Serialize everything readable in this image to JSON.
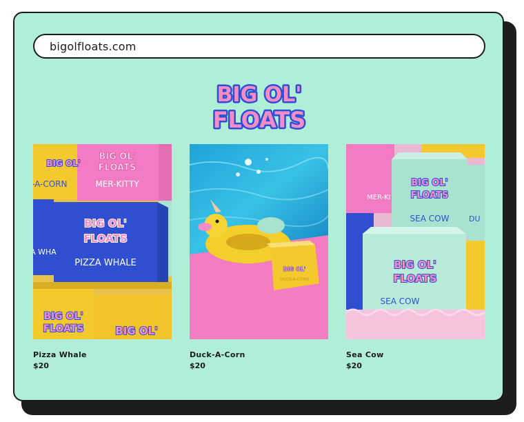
{
  "browser": {
    "url": "bigolfloats.com"
  },
  "brand": {
    "logo_line1": "BIG OL'",
    "logo_line2": "FLOATS"
  },
  "products": [
    {
      "name": "Pizza Whale",
      "price": "$20"
    },
    {
      "name": "Duck-A-Corn",
      "price": "$20"
    },
    {
      "name": "Sea Cow",
      "price": "$20"
    }
  ],
  "box_labels": {
    "pizza_whale": "PIZZA WHALE",
    "mer_kitty": "MER-KITTY",
    "duck_a_corn_partial": "-A-CORN",
    "sea_cow": "SEA COW",
    "duck_partial": "DU",
    "duck_a_corn": "DUCK-A-CORN"
  },
  "colors": {
    "background": "#b0eed8",
    "border": "#1b1b1b",
    "logo_pink": "#f58cc6",
    "logo_blue": "#2d4fd6",
    "box_blue": "#2f4fd0",
    "box_pink": "#f27bc3",
    "box_yellow": "#f4c92e",
    "box_mint": "#a9e3cf"
  }
}
